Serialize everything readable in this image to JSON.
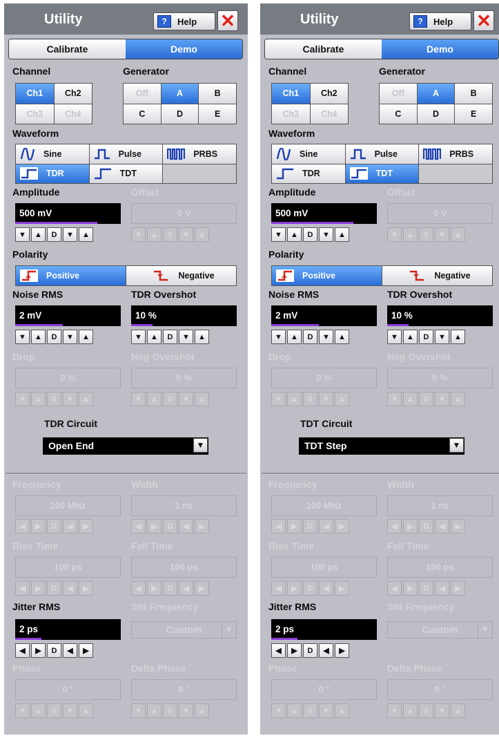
{
  "panels": [
    {
      "title": "Utility",
      "help_label": "Help",
      "tabs": [
        {
          "label": "Calibrate",
          "selected": false
        },
        {
          "label": "Demo",
          "selected": true
        }
      ],
      "channel": {
        "label": "Channel",
        "buttons": [
          {
            "label": "Ch1",
            "state": "sel"
          },
          {
            "label": "Ch2",
            "state": "on"
          },
          {
            "label": "Ch3",
            "state": "dis"
          },
          {
            "label": "Ch4",
            "state": "dis"
          }
        ]
      },
      "generator": {
        "label": "Generator",
        "buttons": [
          {
            "label": "Off",
            "state": "dis"
          },
          {
            "label": "A",
            "state": "sel"
          },
          {
            "label": "B",
            "state": "on"
          },
          {
            "label": "C",
            "state": "on"
          },
          {
            "label": "D",
            "state": "on"
          },
          {
            "label": "E",
            "state": "on"
          }
        ]
      },
      "waveform": {
        "label": "Waveform",
        "buttons": [
          {
            "label": "Sine",
            "icon": "sine-icon",
            "state": "on"
          },
          {
            "label": "Pulse",
            "icon": "pulse-icon",
            "state": "on"
          },
          {
            "label": "PRBS",
            "icon": "prbs-icon",
            "state": "on"
          },
          {
            "label": "TDR",
            "icon": "step-icon",
            "state": "sel"
          },
          {
            "label": "TDT",
            "icon": "step-icon",
            "state": "on"
          },
          {
            "label": "",
            "icon": "",
            "state": "empty"
          }
        ]
      },
      "amplitude": {
        "label": "Amplitude",
        "value": "500 mV",
        "level": 0.78
      },
      "offset": {
        "label": "Offset",
        "value": "0 V"
      },
      "polarity": {
        "label": "Polarity",
        "positive": "Positive",
        "negative": "Negative",
        "selected": "positive"
      },
      "noise_rms": {
        "label": "Noise RMS",
        "value": "2 mV",
        "level": 0.45
      },
      "tdr_overshot": {
        "label": "TDR Overshot",
        "value": "10 %",
        "level": 0.2
      },
      "drop": {
        "label": "Drop",
        "value": "0 %"
      },
      "neg_overshot": {
        "label": "Neg Overshot",
        "value": "0 %"
      },
      "circuit": {
        "label": "TDR Circuit",
        "value": "Open End"
      },
      "frequency": {
        "label": "Frequency",
        "value": "100 MHz"
      },
      "width": {
        "label": "Width",
        "value": "1 ns"
      },
      "rise_time": {
        "label": "Rise Time",
        "value": "100 ps"
      },
      "fall_time": {
        "label": "Fall Time",
        "value": "100 ps"
      },
      "jitter_rms": {
        "label": "Jitter RMS",
        "value": "2 ps",
        "level": 0.25
      },
      "std_frequency": {
        "label": "Std Frequency",
        "value": "Custom"
      },
      "phase": {
        "label": "Phase",
        "value": "0 °"
      },
      "delta_phase": {
        "label": "Delta Phase",
        "value": "0 °"
      }
    },
    {
      "title": "Utility",
      "help_label": "Help",
      "tabs": [
        {
          "label": "Calibrate",
          "selected": false
        },
        {
          "label": "Demo",
          "selected": true
        }
      ],
      "channel": {
        "label": "Channel",
        "buttons": [
          {
            "label": "Ch1",
            "state": "sel"
          },
          {
            "label": "Ch2",
            "state": "on"
          },
          {
            "label": "Ch3",
            "state": "dis"
          },
          {
            "label": "Ch4",
            "state": "dis"
          }
        ]
      },
      "generator": {
        "label": "Generator",
        "buttons": [
          {
            "label": "Off",
            "state": "dis"
          },
          {
            "label": "A",
            "state": "sel"
          },
          {
            "label": "B",
            "state": "on"
          },
          {
            "label": "C",
            "state": "on"
          },
          {
            "label": "D",
            "state": "on"
          },
          {
            "label": "E",
            "state": "on"
          }
        ]
      },
      "waveform": {
        "label": "Waveform",
        "buttons": [
          {
            "label": "Sine",
            "icon": "sine-icon",
            "state": "on"
          },
          {
            "label": "Pulse",
            "icon": "pulse-icon",
            "state": "on"
          },
          {
            "label": "PRBS",
            "icon": "prbs-icon",
            "state": "on"
          },
          {
            "label": "TDR",
            "icon": "step-icon",
            "state": "on"
          },
          {
            "label": "TDT",
            "icon": "step-icon",
            "state": "sel"
          },
          {
            "label": "",
            "icon": "",
            "state": "empty"
          }
        ]
      },
      "amplitude": {
        "label": "Amplitude",
        "value": "500 mV",
        "level": 0.78
      },
      "offset": {
        "label": "Offset",
        "value": "0 V"
      },
      "polarity": {
        "label": "Polarity",
        "positive": "Positive",
        "negative": "Negative",
        "selected": "positive"
      },
      "noise_rms": {
        "label": "Noise RMS",
        "value": "2 mV",
        "level": 0.45
      },
      "tdr_overshot": {
        "label": "TDR Overshot",
        "value": "10 %",
        "level": 0.2
      },
      "drop": {
        "label": "Drop",
        "value": "0 %"
      },
      "neg_overshot": {
        "label": "Neg Overshot",
        "value": "0 %"
      },
      "circuit": {
        "label": "TDT Circuit",
        "value": "TDT Step"
      },
      "frequency": {
        "label": "Frequency",
        "value": "100 MHz"
      },
      "width": {
        "label": "Width",
        "value": "1 ns"
      },
      "rise_time": {
        "label": "Rise Time",
        "value": "100 ps"
      },
      "fall_time": {
        "label": "Fall Time",
        "value": "100 ps"
      },
      "jitter_rms": {
        "label": "Jitter RMS",
        "value": "2 ps",
        "level": 0.25
      },
      "std_frequency": {
        "label": "Std Frequency",
        "value": "Custom"
      },
      "phase": {
        "label": "Phase",
        "value": "0 °"
      },
      "delta_phase": {
        "label": "Delta Phase",
        "value": "0 °"
      }
    }
  ],
  "step_controls": {
    "vertical": [
      "▼",
      "▲",
      "D",
      "▼",
      "▲"
    ],
    "horizontal": [
      "◀",
      "▶",
      "D",
      "◀",
      "▶"
    ],
    "disabled": [
      "▼",
      "▲",
      "0",
      "▼",
      "▲"
    ],
    "disabled_h": [
      "◀",
      "▶",
      "D",
      "◀",
      "▶"
    ]
  },
  "colors": {
    "selected": "#2a6ed9",
    "panel": "#bdbec6",
    "titlebar": "#777b82",
    "close": "#e32219",
    "level_bar": "#8a3cd8"
  }
}
